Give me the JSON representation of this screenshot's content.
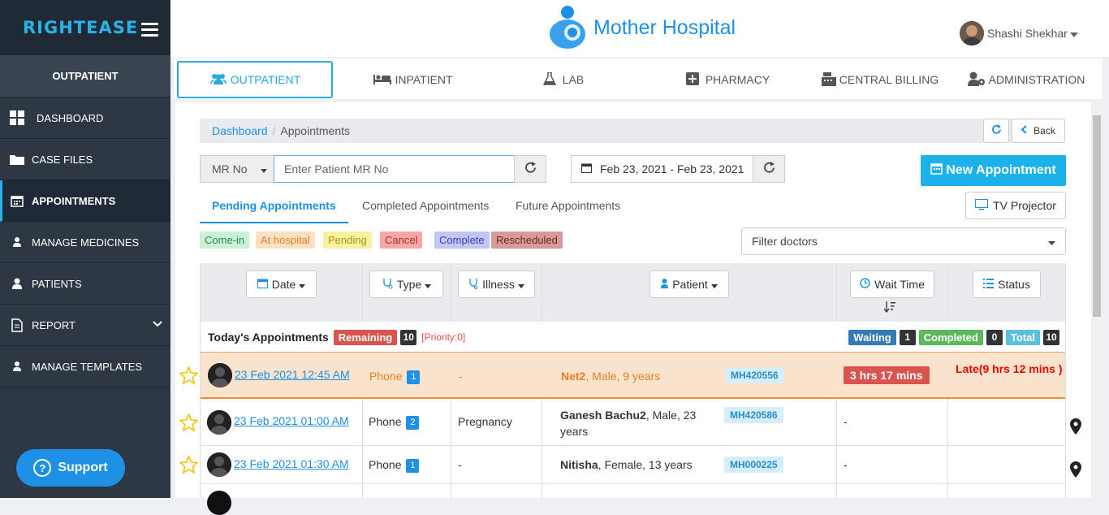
{
  "brand": {
    "logo": "RIGHTEASE",
    "hospital_name": "Mother Hospital"
  },
  "user": {
    "name": "Shashi Shekhar"
  },
  "sidebar": {
    "section": "OUTPATIENT",
    "items": [
      {
        "label": "DASHBOARD",
        "icon": "dashboard-icon"
      },
      {
        "label": "CASE FILES",
        "icon": "folder-icon"
      },
      {
        "label": "APPOINTMENTS",
        "icon": "calendar-icon",
        "active": true
      },
      {
        "label": "MANAGE MEDICINES",
        "icon": "user-icon"
      },
      {
        "label": "PATIENTS",
        "icon": "user-icon"
      },
      {
        "label": "REPORT",
        "icon": "document-icon"
      },
      {
        "label": "MANAGE TEMPLATES",
        "icon": "user-icon"
      }
    ],
    "support": "Support"
  },
  "nav": {
    "tabs": [
      {
        "label": "OUTPATIENT"
      },
      {
        "label": "INPATIENT"
      },
      {
        "label": "LAB"
      },
      {
        "label": "PHARMACY"
      },
      {
        "label": "CENTRAL BILLING"
      },
      {
        "label": "ADMINISTRATION"
      }
    ]
  },
  "breadcrumb": {
    "root": "Dashboard",
    "current": "Appointments",
    "back": "Back"
  },
  "search": {
    "select_value": "MR No",
    "placeholder": "Enter Patient MR No",
    "date_range": "Feb 23, 2021 - Feb 23, 2021"
  },
  "actions": {
    "new_appointment": "New Appointment",
    "tv_projector": "TV Projector"
  },
  "subtabs": [
    "Pending Appointments",
    "Completed Appointments",
    "Future Appointments"
  ],
  "legend": [
    {
      "label": "Come-in",
      "bg": "#c9f0d8",
      "color": "#2a8a4a"
    },
    {
      "label": "At hospital",
      "bg": "#fce0c4",
      "color": "#e67e22"
    },
    {
      "label": "Pending",
      "bg": "#f8f1a0",
      "color": "#a6961a"
    },
    {
      "label": "Cancel",
      "bg": "#f5a8a6",
      "color": "#b52b27"
    },
    {
      "label": "Complete",
      "bg": "#c2c6f5",
      "color": "#3b3fb0"
    },
    {
      "label": "Rescheduled",
      "bg": "#d39c98",
      "color": "#7a2622"
    }
  ],
  "filter": {
    "placeholder": "Filter doctors"
  },
  "columns": {
    "date": "Date",
    "type": "Type",
    "illness": "Illness",
    "patient": "Patient",
    "wait": "Wait Time",
    "status": "Status"
  },
  "today": {
    "title": "Today's Appointments",
    "remaining_label": "Remaining",
    "remaining": "10",
    "priority": "[Priority:0]",
    "waiting_label": "Waiting",
    "waiting": "1",
    "completed_label": "Completed",
    "completed": "0",
    "total_label": "Total",
    "total": "10"
  },
  "rows": [
    {
      "date": "23 Feb 2021 12:45 AM",
      "type": "Phone",
      "num": "1",
      "illness": "-",
      "patient_name": "Net2",
      "patient_info": ", Male, 9 years",
      "mr": "MH420556",
      "wait": "3 hrs 17 mins",
      "status": "Late(9 hrs 12 mins )"
    },
    {
      "date": "23 Feb 2021 01:00 AM",
      "type": "Phone",
      "num": "2",
      "illness": "Pregnancy",
      "patient_name": "Ganesh Bachu2",
      "patient_info": ", Male, 23 years",
      "mr": "MH420586",
      "wait": "-",
      "status": ""
    },
    {
      "date": "23 Feb 2021 01:30 AM",
      "type": "Phone",
      "num": "1",
      "illness": "-",
      "patient_name": "Nitisha",
      "patient_info": ", Female, 13 years",
      "mr": "MH000225",
      "wait": "-",
      "status": ""
    }
  ]
}
